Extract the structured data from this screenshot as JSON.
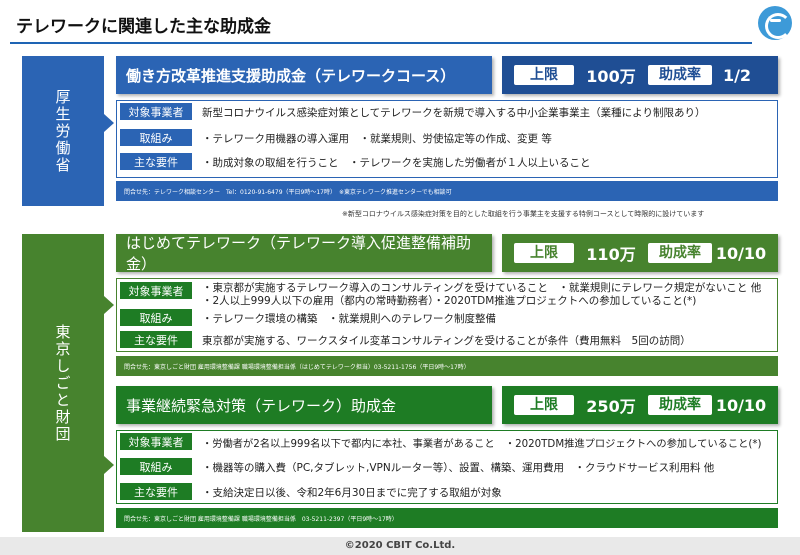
{
  "header": {
    "title": "テレワークに関連した主な助成金"
  },
  "colors": {
    "blue": "#2b64b4",
    "blue_dark": "#1f4e94",
    "green": "#47832e",
    "green_dark": "#1e7c24"
  },
  "mhlw": {
    "ministry": "厚生労働省",
    "title": "働き方改革推進支援助成金（テレワークコース）",
    "limit_label": "上限",
    "limit_value": "100万",
    "rate_label": "助成率",
    "rate_value": "1/2",
    "rows": [
      {
        "label": "対象事業者",
        "text": "新型コロナウイルス感染症対策としてテレワークを新規で導入する中小企業事業主（業種により制限あり）"
      },
      {
        "label": "取組み",
        "text": "・テレワーク用機器の導入運用　・就業規則、労使協定等の作成、変更 等"
      },
      {
        "label": "主な要件",
        "text": "・助成対象の取組を行うこと　・テレワークを実施した労働者が１人以上いること"
      }
    ],
    "contact": "問合せ先：テレワーク相談センター　Tel：0120-91-6479（平日9時～17時）　※東京テレワーク推進センターでも相談可",
    "note": "※新型コロナウイルス感染症対策を目的とした取組を行う事業主を支援する特例コースとして時限的に設けています"
  },
  "tokyo": {
    "ministry": "東京しごと財団",
    "first": {
      "title": "はじめてテレワーク（テレワーク導入促進整備補助金）",
      "limit_label": "上限",
      "limit_value": "110万",
      "rate_label": "助成率",
      "rate_value": "10/10",
      "target_label": "対象事業者",
      "target_line1": "・東京都が実施するテレワーク導入のコンサルティングを受けていること　・就業規則にテレワーク規定がないこと 他",
      "target_line2": "・2人以上999人以下の雇用（都内の常時勤務者）・2020TDM推進プロジェクトへの参加していること(*)",
      "effort_label": "取組み",
      "effort_text": "・テレワーク環境の構築　・就業規則へのテレワーク制度整備",
      "req_label": "主な要件",
      "req_text": "東京都が実施する、ワークスタイル変革コンサルティングを受けることが条件（費用無料　5回の訪問）",
      "contact": "問合せ先：東京しごと財団 雇用環境整備課 職場環境整備担当係（はじめてテレワーク担当）03-5211-1756（平日9時～17時）"
    },
    "second": {
      "title": "事業継続緊急対策（テレワーク）助成金",
      "limit_label": "上限",
      "limit_value": "250万",
      "rate_label": "助成率",
      "rate_value": "10/10",
      "rows": [
        {
          "label": "対象事業者",
          "text": "・労働者が2名以上999名以下で都内に本社、事業者があること　・2020TDM推進プロジェクトへの参加していること(*)"
        },
        {
          "label": "取組み",
          "text": "・機器等の購入費（PC,タブレット,VPNルーター等）、設置、構築、運用費用　・クラウドサービス利用料 他"
        },
        {
          "label": "主な要件",
          "text": "・支給決定日以後、令和2年6月30日までに完了する取組が対象"
        }
      ],
      "contact": "問合せ先：東京しごと財団 雇用環境整備課 職場環境整備担当係　03-5211-2397（平日9時～17時）"
    }
  },
  "footer": {
    "copyright": "©2020  CBIT Co.Ltd."
  }
}
